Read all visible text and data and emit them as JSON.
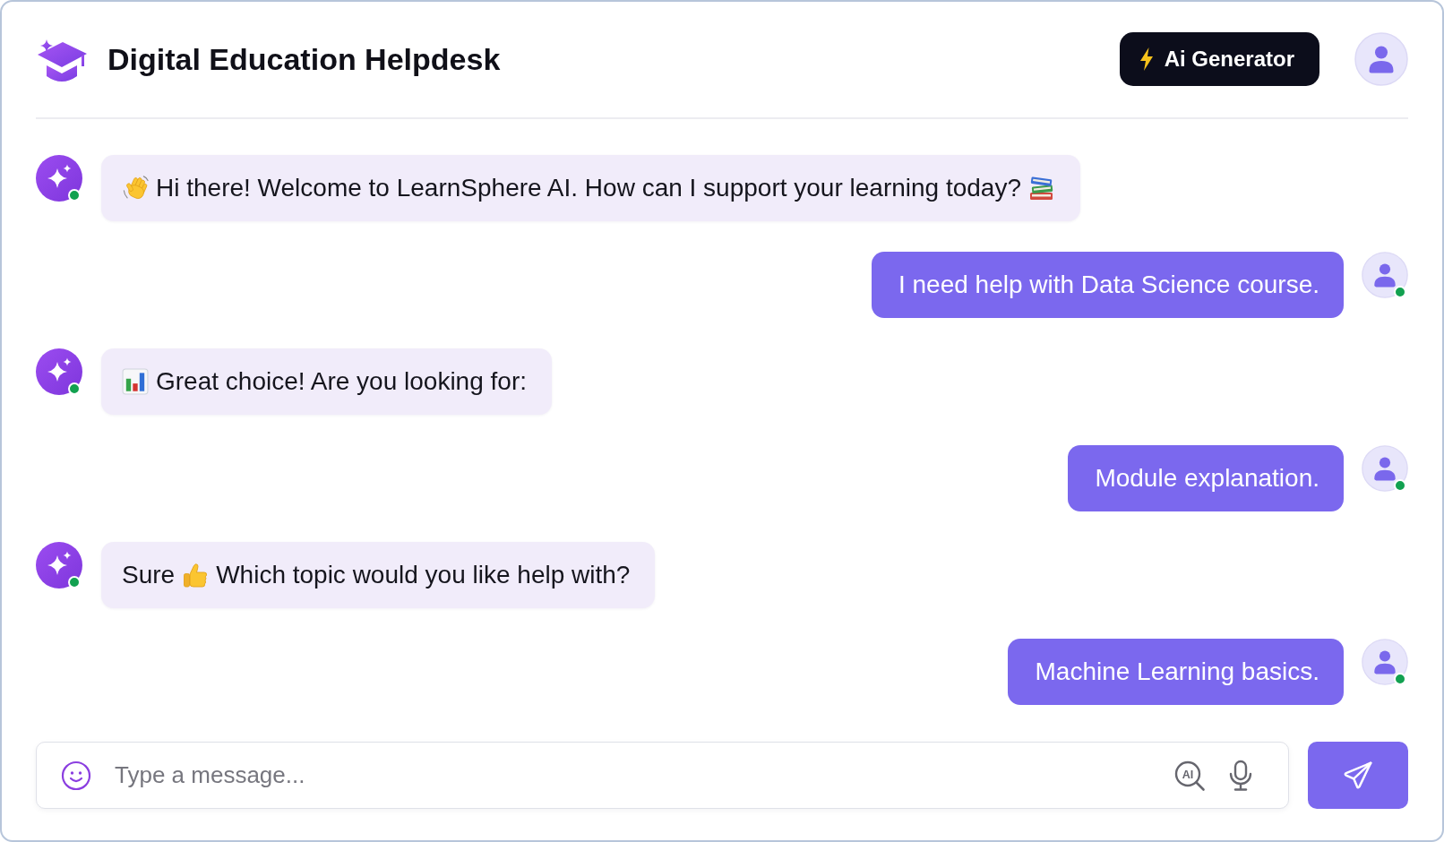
{
  "header": {
    "title": "Digital Education Helpdesk",
    "generate_button": {
      "label": "Ai Generator"
    }
  },
  "messages": [
    {
      "kind": "bot",
      "online": true,
      "parts": [
        {
          "kind": "wave"
        },
        {
          "kind": "text",
          "text": "Hi there! Welcome to LearnSphere AI. How can I support your learning today?"
        },
        {
          "kind": "books"
        }
      ]
    },
    {
      "kind": "user",
      "online": true,
      "parts": [
        {
          "kind": "text",
          "text": "I need help with Data Science course."
        }
      ]
    },
    {
      "kind": "bot",
      "online": true,
      "parts": [
        {
          "kind": "chart"
        },
        {
          "kind": "text",
          "text": "Great choice! Are you looking for:"
        }
      ]
    },
    {
      "kind": "user",
      "online": true,
      "parts": [
        {
          "kind": "text",
          "text": "Module explanation."
        }
      ]
    },
    {
      "kind": "bot",
      "online": true,
      "parts": [
        {
          "kind": "text",
          "text": "Sure"
        },
        {
          "kind": "thumbs"
        },
        {
          "kind": "text",
          "text": "Which topic would you like help with?"
        }
      ]
    },
    {
      "kind": "user",
      "online": true,
      "parts": [
        {
          "kind": "text",
          "text": "Machine Learning basics."
        }
      ]
    }
  ],
  "composer": {
    "placeholder": "Type a message...",
    "tools": [
      {
        "kind": "ai",
        "label": "AI"
      },
      {
        "kind": "mic"
      }
    ]
  }
}
